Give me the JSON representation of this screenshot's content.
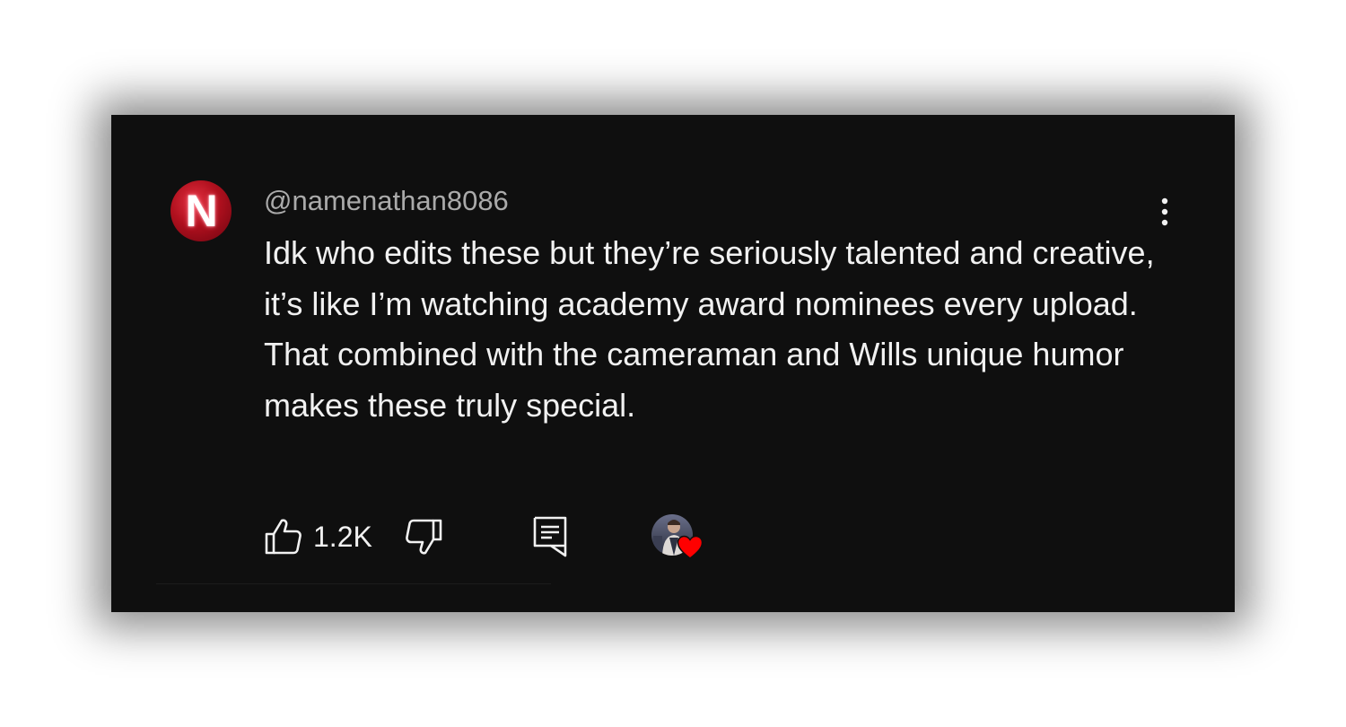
{
  "comment": {
    "avatar_letter": "N",
    "handle": "@namenathan8086",
    "text": "Idk who edits these but they’re seriously talented and creative, it’s like I’m watching academy award nominees every upload. That combined with the cameraman and Wills unique humor makes these truly special.",
    "like_count": "1.2K",
    "creator_hearted": true
  },
  "icons": {
    "more": "more-vertical-icon",
    "like": "thumbs-up-icon",
    "dislike": "thumbs-down-icon",
    "reply": "reply-comment-icon",
    "heart": "heart-icon"
  },
  "colors": {
    "background": "#0f0f0f",
    "text": "#f1f1f1",
    "handle": "#aaaaaa",
    "avatar": "#c0111f",
    "heart": "#ff0000"
  }
}
